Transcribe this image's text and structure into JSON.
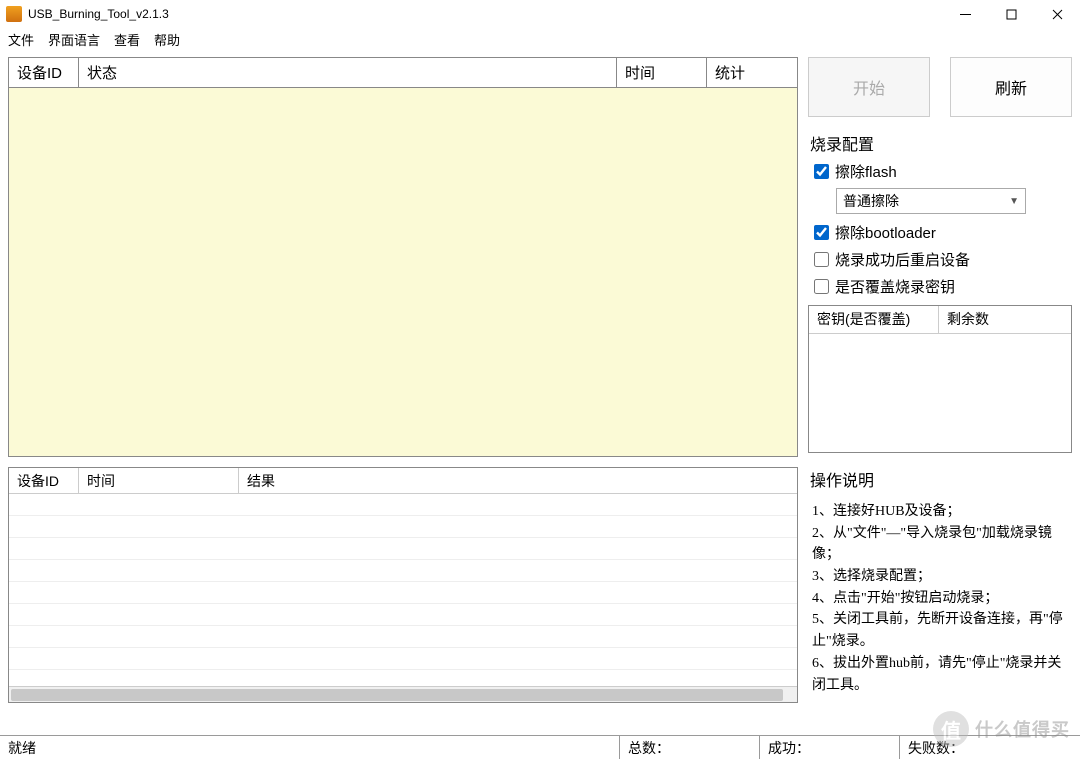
{
  "window": {
    "title": "USB_Burning_Tool_v2.1.3"
  },
  "menu": {
    "file": "文件",
    "lang": "界面语言",
    "view": "查看",
    "help": "帮助"
  },
  "topTable": {
    "col_id": "设备ID",
    "col_status": "状态",
    "col_time": "时间",
    "col_stat": "统计"
  },
  "botTable": {
    "col_id": "设备ID",
    "col_time": "时间",
    "col_result": "结果"
  },
  "buttons": {
    "start": "开始",
    "refresh": "刷新"
  },
  "config": {
    "title": "烧录配置",
    "erase_flash": "擦除flash",
    "erase_mode": "普通擦除",
    "erase_bootloader": "擦除bootloader",
    "reboot_after": "烧录成功后重启设备",
    "overwrite_key": "是否覆盖烧录密钥"
  },
  "keyTable": {
    "col_key": "密钥(是否覆盖)",
    "col_remain": "剩余数"
  },
  "instructions": {
    "title": "操作说明",
    "s1": "1、连接好HUB及设备；",
    "s2": "2、从\"文件\"—\"导入烧录包\"加载烧录镜像；",
    "s3": "3、选择烧录配置；",
    "s4": "4、点击\"开始\"按钮启动烧录；",
    "s5": "5、关闭工具前，先断开设备连接，再\"停止\"烧录。",
    "s6": "6、拔出外置hub前，请先\"停止\"烧录并关闭工具。"
  },
  "status": {
    "ready": "就绪",
    "total": "总数：",
    "success": "成功：",
    "fail": "失败数："
  },
  "watermark": {
    "icon": "值",
    "text": "什么值得买"
  }
}
